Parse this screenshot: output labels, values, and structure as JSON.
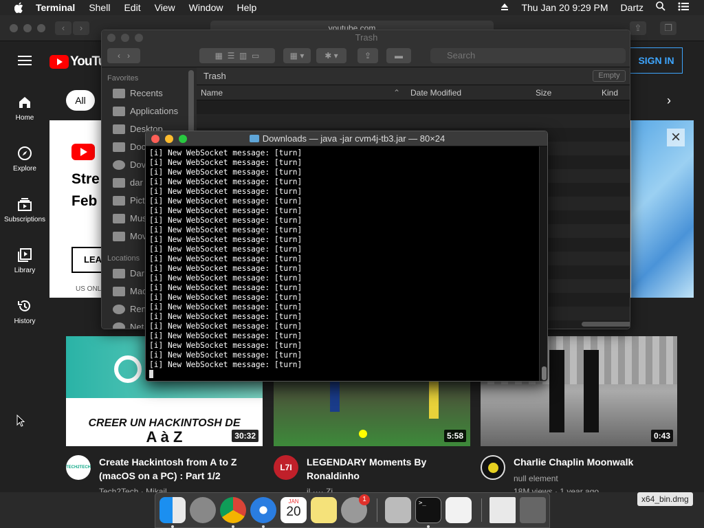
{
  "menubar": {
    "app_name": "Terminal",
    "menus": [
      "Shell",
      "Edit",
      "View",
      "Window",
      "Help"
    ],
    "datetime": "Thu Jan 20  9:29 PM",
    "user": "Dartz"
  },
  "browser": {
    "url": "youtube.com"
  },
  "youtube": {
    "logo": "YouTube",
    "signin": "SIGN IN",
    "chip_all": "All",
    "nav": [
      {
        "label": "Home"
      },
      {
        "label": "Explore"
      },
      {
        "label": "Subscriptions"
      },
      {
        "label": "Library"
      },
      {
        "label": "History"
      }
    ],
    "banner": {
      "line1": "Stre",
      "line2": "Feb",
      "button": "LEA",
      "footnote": "US ONL"
    },
    "videos": [
      {
        "thumb_text_1": "CREER UN HACKINTOSH DE",
        "thumb_text_2": "A à Z",
        "duration": "30:32",
        "title_1": "Create Hackintosh from A to Z",
        "title_2": "(macOS on a PC) : Part 1/2",
        "meta": "Tech2Tech · Mikail",
        "avatar_text": "TECH2TECH"
      },
      {
        "duration": "5:58",
        "title_1": "LEGENDARY Moments By",
        "title_2": "Ronaldinho",
        "meta": "il ···· Zi",
        "avatar_text": "L7I"
      },
      {
        "duration": "0:43",
        "title_1": "Charlie Chaplin Moonwalk",
        "meta": "null element",
        "meta2": "18M views · 1 year ago"
      }
    ]
  },
  "finder": {
    "title": "Trash",
    "search_placeholder": "Search",
    "path": "Trash",
    "empty_button": "Empty",
    "columns": [
      "Name",
      "Date Modified",
      "Size",
      "Kind"
    ],
    "sidebar": {
      "favorites_header": "Favorites",
      "favorites": [
        "Recents",
        "Applications",
        "Desktop",
        "Doc",
        "Dov",
        "dar",
        "Pict",
        "Mus",
        "Mov"
      ],
      "locations_header": "Locations",
      "locations": [
        "Dar",
        "Mac",
        "Ren",
        "Net"
      ]
    }
  },
  "terminal": {
    "title": "Downloads — java -jar cvm4j-tb3.jar — 80×24",
    "lines": [
      "[i] New WebSocket message: [turn]",
      "[i] New WebSocket message: [turn]",
      "[i] New WebSocket message: [turn]",
      "[i] New WebSocket message: [turn]",
      "[i] New WebSocket message: [turn]",
      "[i] New WebSocket message: [turn]",
      "[i] New WebSocket message: [turn]",
      "[i] New WebSocket message: [turn]",
      "[i] New WebSocket message: [turn]",
      "[i] New WebSocket message: [turn]",
      "[i] New WebSocket message: [turn]",
      "[i] New WebSocket message: [turn]",
      "[i] New WebSocket message: [turn]",
      "[i] New WebSocket message: [turn]",
      "[i] New WebSocket message: [turn]",
      "[i] New WebSocket message: [turn]",
      "[i] New WebSocket message: [turn]",
      "[i] New WebSocket message: [turn]",
      "[i] New WebSocket message: [turn]",
      "[i] New WebSocket message: [turn]",
      "[i] New WebSocket message: [turn]",
      "[i] New WebSocket message: [turn]",
      "[i] New WebSocket message: [turn]"
    ]
  },
  "dock": {
    "calendar_month": "JAN",
    "calendar_day": "20",
    "badge": "1",
    "file_label": "x64_bin.dmg"
  },
  "colors": {
    "youtube_red": "#ff0000",
    "signin_blue": "#3ea6ff",
    "close_red": "#ff5f57",
    "minimize_yellow": "#febc2e",
    "zoom_green": "#28c840"
  }
}
